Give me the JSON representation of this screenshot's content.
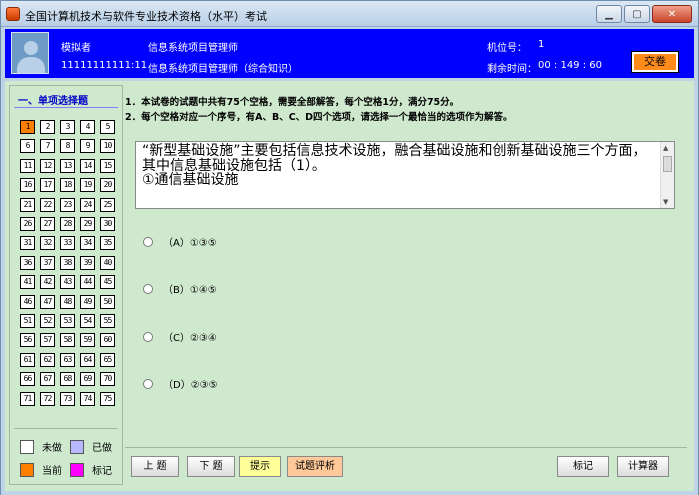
{
  "window": {
    "title": "全国计算机技术与软件专业技术资格（水平）考试",
    "controls": [
      "▁",
      "▢",
      "✕"
    ]
  },
  "header": {
    "name_label": "模拟者",
    "exam_name": "信息系统项目管理师",
    "candidate_id": "11111111111:11",
    "subject": "信息系统项目管理师（综合知识）",
    "seat_label": "机位号：",
    "seat_value": "1",
    "remaining_label": "剩余时间：",
    "remaining_value": "00 : 149 : 60",
    "submit_label": "交卷"
  },
  "sidebar": {
    "title": "一、单项选择题",
    "questions": [
      "1",
      "2",
      "3",
      "4",
      "5",
      "6",
      "7",
      "8",
      "9",
      "10",
      "11",
      "12",
      "13",
      "14",
      "15",
      "16",
      "17",
      "18",
      "19",
      "20",
      "21",
      "22",
      "23",
      "24",
      "25",
      "26",
      "27",
      "28",
      "29",
      "30",
      "31",
      "32",
      "33",
      "34",
      "35",
      "36",
      "37",
      "38",
      "39",
      "40",
      "41",
      "42",
      "43",
      "44",
      "45",
      "46",
      "47",
      "48",
      "49",
      "50",
      "51",
      "52",
      "53",
      "54",
      "55",
      "56",
      "57",
      "58",
      "59",
      "60",
      "61",
      "62",
      "63",
      "64",
      "65",
      "66",
      "67",
      "68",
      "69",
      "70",
      "71",
      "72",
      "73",
      "74",
      "75"
    ],
    "current_index": 0,
    "legend": {
      "not_done": "未做",
      "done": "已做",
      "current": "当前",
      "marked": "标记"
    },
    "legend_colors": {
      "not_done": "#ffffff",
      "done": "#b8b8ff",
      "current": "#ff8000",
      "marked": "#ff00ff"
    }
  },
  "instructions": [
    "1．本试卷的试题中共有75个空格，需要全部解答，每个空格1分，满分75分。",
    "2．每个空格对应一个序号，有A、B、C、D四个选项，请选择一个最恰当的选项作为解答。"
  ],
  "question": {
    "text": "“新型基础设施”主要包括信息技术设施，融合基础设施和创新基础设施三个方面，其中信息基础设施包括（1）。\n①通信基础设施"
  },
  "options": [
    {
      "label": "（A）①③⑤"
    },
    {
      "label": "（B）①④⑤"
    },
    {
      "label": "（C）②③④"
    },
    {
      "label": "（D）②③⑤"
    }
  ],
  "buttons": {
    "prev": "上  题",
    "next": "下  题",
    "hint": "提示",
    "trial": "试题评析",
    "mark": "标记",
    "calculator": "计算器"
  }
}
